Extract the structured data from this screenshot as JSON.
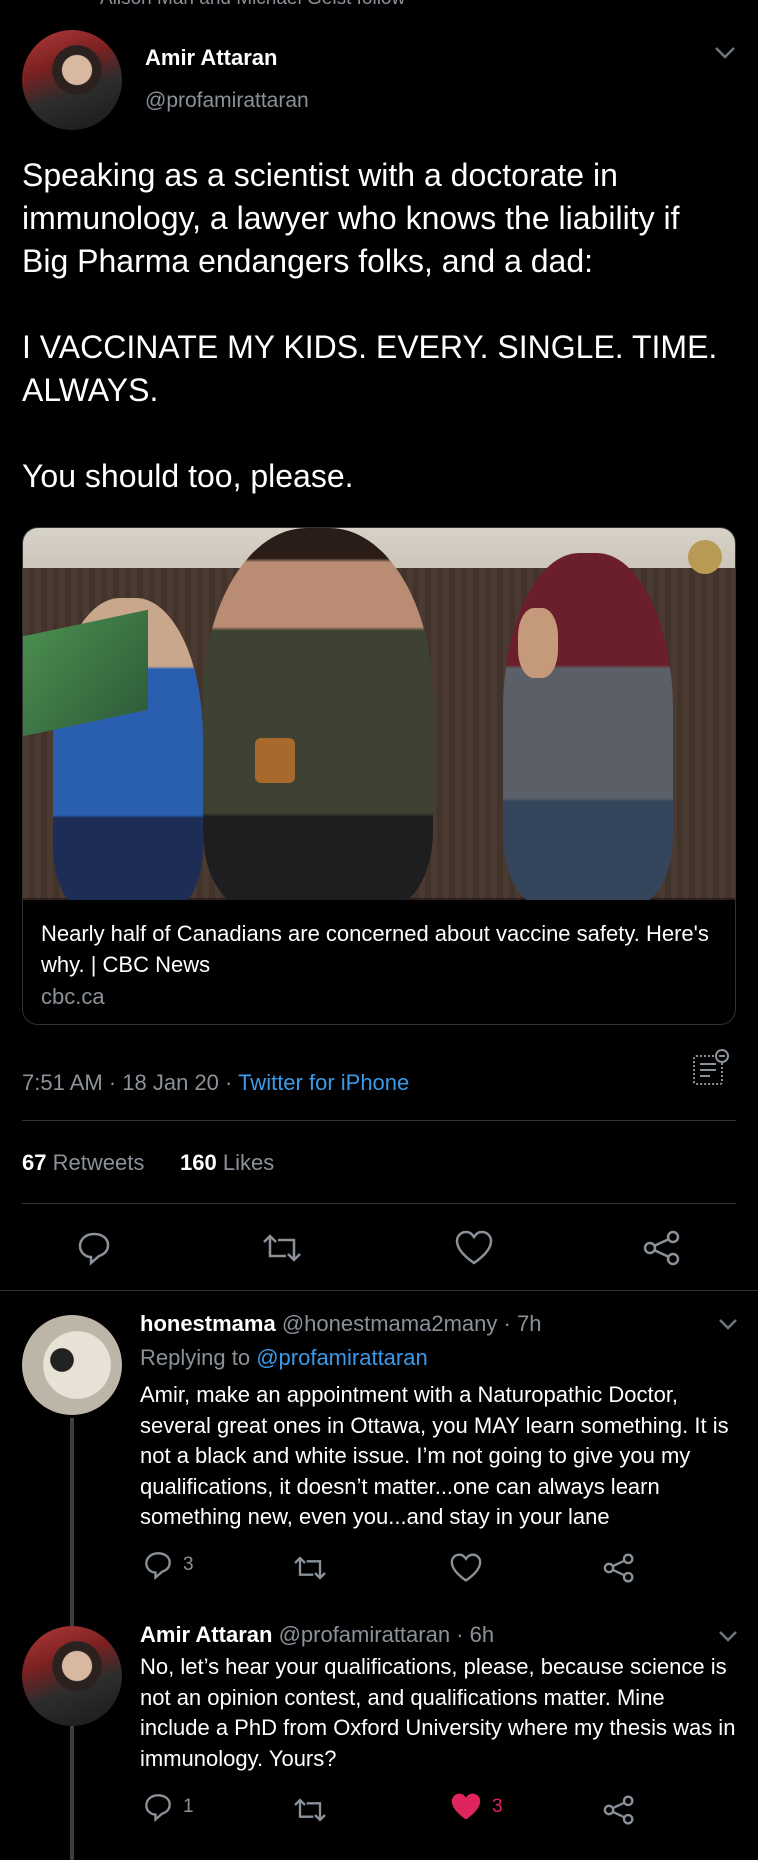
{
  "top_context": "Alison Man and Michael Geist follow",
  "tweet": {
    "author_name": "Amir Attaran",
    "author_handle": "@profamirattaran",
    "text_p1": "Speaking as a scientist with a doctorate in immunology, a lawyer who knows the liability if Big Pharma endangers folks, and a dad:",
    "text_p2": "I VACCINATE MY KIDS.  EVERY. SINGLE. TIME. ALWAYS.",
    "text_p3": "You should too, please.",
    "card": {
      "title": "Nearly half of Canadians are concerned about vaccine safety. Here's why. | CBC News",
      "domain": "cbc.ca"
    },
    "time": "7:51 AM",
    "date": "18 Jan 20",
    "source": "Twitter for iPhone",
    "retweets_count": "67",
    "retweets_label": "Retweets",
    "likes_count": "160",
    "likes_label": "Likes"
  },
  "replies": [
    {
      "author_name": "honestmama",
      "author_handle": "@honestmama2many",
      "age": "7h",
      "replying_prefix": "Replying to",
      "replying_to": "@profamirattaran",
      "text": "Amir, make an appointment with a Naturopathic Doctor, several great ones in Ottawa, you MAY learn something. It is not a black and white issue. I’m not going to give you my qualifications, it doesn’t matter...one can always learn something new, even you...and stay in your lane",
      "reply_count": "3",
      "like_count": ""
    },
    {
      "author_name": "Amir Attaran",
      "author_handle": "@profamirattaran",
      "age": "6h",
      "text": "No, let’s hear your qualifications, please, because science is not an opinion contest, and qualifications matter.  Mine include a PhD from Oxford University where my thesis was in immunology.  Yours?",
      "reply_count": "1",
      "like_count": "3"
    }
  ],
  "colors": {
    "background": "#000000",
    "link": "#3b9ae8",
    "muted": "#8a9199",
    "like_active": "#e0245e"
  }
}
